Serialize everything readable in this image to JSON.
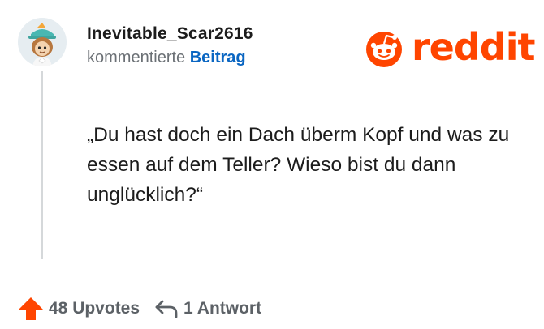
{
  "post": {
    "username": "Inevitable_Scar2616",
    "action": "kommentierte",
    "target": "Beitrag",
    "text": "„Du hast doch ein Dach überm Kopf und was zu essen auf dem Teller? Wieso bist du dann unglücklich?“"
  },
  "brand": {
    "name": "reddit",
    "color": "#ff4500"
  },
  "footer": {
    "upvotes": "48 Upvotes",
    "replies": "1 Antwort"
  },
  "icons": [
    "avatar",
    "reddit-logo-icon",
    "upvote-arrow-icon",
    "reply-arrow-icon"
  ]
}
